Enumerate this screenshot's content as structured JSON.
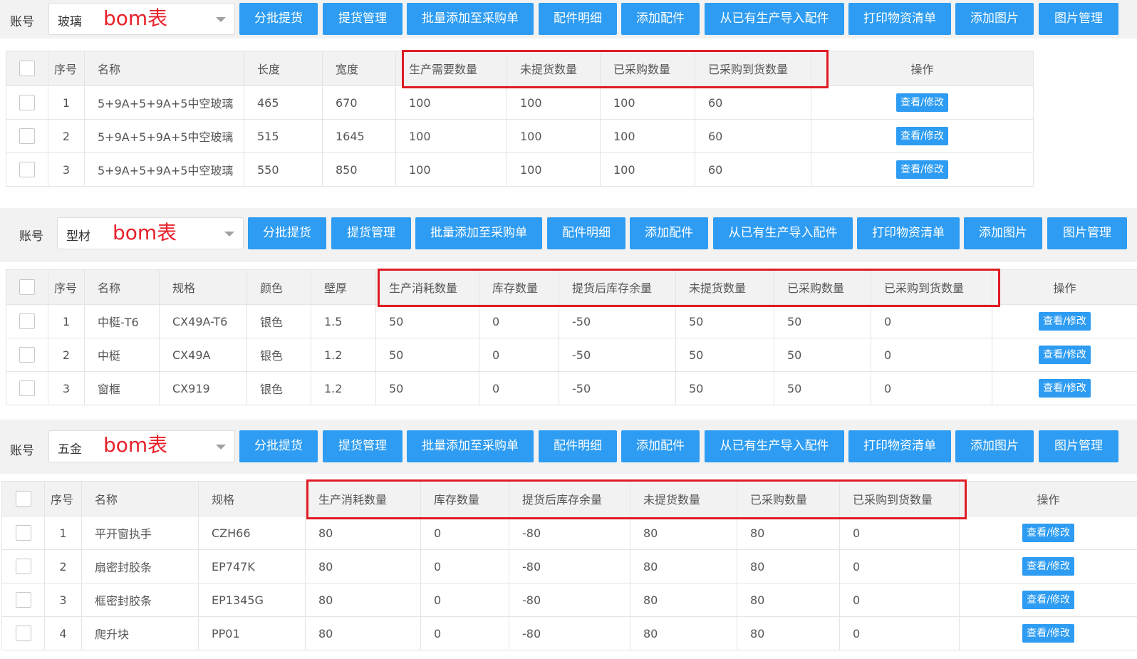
{
  "sections": [
    {
      "account_label": "账号",
      "account_value": "玻璃",
      "annotation": "bom表",
      "buttons": [
        "分批提货",
        "提货管理",
        "批量添加至采购单",
        "配件明细",
        "添加配件",
        "从已有生产导入配件",
        "打印物资清单",
        "添加图片",
        "图片管理"
      ],
      "headers": [
        "",
        "序号",
        "名称",
        "长度",
        "宽度",
        "生产需要数量",
        "未提货数量",
        "已采购数量",
        "已采购到货数量",
        "操作"
      ],
      "rows": [
        [
          "1",
          "5+9A+5+9A+5中空玻璃",
          "465",
          "670",
          "100",
          "100",
          "100",
          "60"
        ],
        [
          "2",
          "5+9A+5+9A+5中空玻璃",
          "515",
          "1645",
          "100",
          "100",
          "100",
          "60"
        ],
        [
          "3",
          "5+9A+5+9A+5中空玻璃",
          "550",
          "850",
          "100",
          "100",
          "100",
          "60"
        ]
      ],
      "action_label": "查看/修改"
    },
    {
      "account_label": "账号",
      "account_value": "型材",
      "annotation": "bom表",
      "buttons": [
        "分批提货",
        "提货管理",
        "批量添加至采购单",
        "配件明细",
        "添加配件",
        "从已有生产导入配件",
        "打印物资清单",
        "添加图片",
        "图片管理"
      ],
      "headers": [
        "",
        "序号",
        "名称",
        "规格",
        "颜色",
        "壁厚",
        "生产消耗数量",
        "库存数量",
        "提货后库存余量",
        "未提货数量",
        "已采购数量",
        "已采购到货数量",
        "操作"
      ],
      "rows": [
        [
          "1",
          "中梃-T6",
          "CX49A-T6",
          "银色",
          "1.5",
          "50",
          "0",
          "-50",
          "50",
          "50",
          "0"
        ],
        [
          "2",
          "中梃",
          "CX49A",
          "银色",
          "1.2",
          "50",
          "0",
          "-50",
          "50",
          "50",
          "0"
        ],
        [
          "3",
          "窗框",
          "CX919",
          "银色",
          "1.2",
          "50",
          "0",
          "-50",
          "50",
          "50",
          "0"
        ]
      ],
      "action_label": "查看/修改"
    },
    {
      "account_label": "账号",
      "account_value": "五金",
      "annotation": "bom表",
      "buttons": [
        "分批提货",
        "提货管理",
        "批量添加至采购单",
        "配件明细",
        "添加配件",
        "从已有生产导入配件",
        "打印物资清单",
        "添加图片",
        "图片管理"
      ],
      "headers": [
        "",
        "序号",
        "名称",
        "规格",
        "生产消耗数量",
        "库存数量",
        "提货后库存余量",
        "未提货数量",
        "已采购数量",
        "已采购到货数量",
        "操作"
      ],
      "rows": [
        [
          "1",
          "平开窗执手",
          "CZH66",
          "80",
          "0",
          "-80",
          "80",
          "80",
          "0"
        ],
        [
          "2",
          "扇密封胶条",
          "EP747K",
          "80",
          "0",
          "-80",
          "80",
          "80",
          "0"
        ],
        [
          "3",
          "框密封胶条",
          "EP1345G",
          "80",
          "0",
          "-80",
          "80",
          "80",
          "0"
        ],
        [
          "4",
          "爬升块",
          "PP01",
          "80",
          "0",
          "-80",
          "80",
          "80",
          "0"
        ]
      ],
      "action_label": "查看/修改"
    }
  ],
  "colors": {
    "button": "#2d9cf2",
    "annotation": "#e8202a",
    "highlight_box": "#e01b24"
  }
}
